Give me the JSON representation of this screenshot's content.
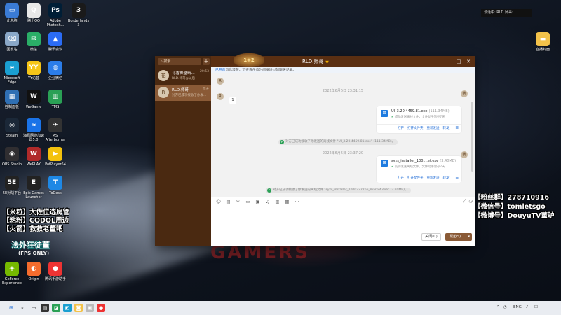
{
  "desktop_icons": [
    {
      "label": "此电脑",
      "color": "#3a7bd5",
      "glyph": "▭",
      "col": 0,
      "row": 0
    },
    {
      "label": "回收站",
      "color": "#8aa8c8",
      "glyph": "⌫",
      "col": 0,
      "row": 1
    },
    {
      "label": "Microsoft Edge",
      "color": "#1a9fd1",
      "glyph": "e",
      "col": 0,
      "row": 2
    },
    {
      "label": "控制面板",
      "color": "#2f6fb3",
      "glyph": "▦",
      "col": 0,
      "row": 3
    },
    {
      "label": "Steam",
      "color": "#1b2838",
      "glyph": "◎",
      "col": 0,
      "row": 4
    },
    {
      "label": "OBS Studio",
      "color": "#302e31",
      "glyph": "◉",
      "col": 0,
      "row": 5
    },
    {
      "label": "5E对战平台",
      "color": "#222",
      "glyph": "5E",
      "col": 0,
      "row": 6
    },
    {
      "label": "GeForce Experience",
      "color": "#76b900",
      "glyph": "◈",
      "col": 0,
      "row": 9
    },
    {
      "label": "腾讯QQ",
      "color": "#e8e8e8",
      "glyph": "Q",
      "col": 1,
      "row": 0
    },
    {
      "label": "微信",
      "color": "#2aae67",
      "glyph": "✉",
      "col": 1,
      "row": 1
    },
    {
      "label": "YY语音",
      "color": "#f5c518",
      "glyph": "YY",
      "col": 1,
      "row": 2
    },
    {
      "label": "WeGame",
      "color": "#111",
      "glyph": "W",
      "col": 1,
      "row": 3
    },
    {
      "label": "海豚网游加速器5.0",
      "color": "#1a73e8",
      "glyph": "≈",
      "col": 1,
      "row": 4
    },
    {
      "label": "WePLAY",
      "color": "#b02a2a",
      "glyph": "W",
      "col": 1,
      "row": 5
    },
    {
      "label": "Epic Games Launcher",
      "color": "#222",
      "glyph": "E",
      "col": 1,
      "row": 6
    },
    {
      "label": "Origin",
      "color": "#f56c2d",
      "glyph": "◐",
      "col": 1,
      "row": 9
    },
    {
      "label": "Adobe Photosh...",
      "color": "#001e36",
      "glyph": "Ps",
      "col": 2,
      "row": 0
    },
    {
      "label": "腾讯会议",
      "color": "#2b6cf6",
      "glyph": "▲",
      "col": 2,
      "row": 1
    },
    {
      "label": "企业微信",
      "color": "#2b7de9",
      "glyph": "◍",
      "col": 2,
      "row": 2
    },
    {
      "label": "TMS",
      "color": "#2aa055",
      "glyph": "▥",
      "col": 2,
      "row": 3
    },
    {
      "label": "MSI Afterburner",
      "color": "#333",
      "glyph": "✈",
      "col": 2,
      "row": 4
    },
    {
      "label": "PotPlayer64",
      "color": "#f4c20d",
      "glyph": "▶",
      "col": 2,
      "row": 5
    },
    {
      "label": "ToDesk",
      "color": "#1e88e5",
      "glyph": "T",
      "col": 2,
      "row": 6
    },
    {
      "label": "腾讯手游助手",
      "color": "#e33",
      "glyph": "●",
      "col": 2,
      "row": 9
    },
    {
      "label": "Borderlands 3",
      "color": "#1a1a1a",
      "glyph": "3",
      "col": 3,
      "row": 0
    },
    {
      "label": "直播封面",
      "color": "#f3c24a",
      "glyph": "▬",
      "col": 4,
      "row": 1
    }
  ],
  "notice": "谈话中: RLD.师哥:",
  "overlay_left": [
    "【米粒】大佐位选房管",
    "【粘粉】CODOL周边",
    "【火箭】救救老董吧"
  ],
  "overlay_right": [
    "【粉丝群】278710916",
    "【微信号】tomletsgo",
    "【微博号】DouyuTV董驴"
  ],
  "cam_badge": "法外狂徒董",
  "fps_badge": "(FPS ONLY)",
  "wallpaper_text": "GAMERS",
  "qq": {
    "title": "RLD.师哥",
    "dragon_text": "1+2",
    "search_placeholder": "搜索",
    "win_min": "–",
    "win_max": "□",
    "win_close": "✕",
    "conversations": [
      {
        "name": "花香椰壁纸...",
        "time": "20:53",
        "preview": "RLD.师哥@以后",
        "avatar": "花",
        "active": false
      },
      {
        "name": "RLD.师哥",
        "time": "昨天",
        "preview": "对方已成功接收了你发...",
        "avatar": "R",
        "active": true
      }
    ],
    "notice_prefix": "已开启",
    "notice_text": "消息漫游，可查看任意时间发送过的聊天记录。",
    "timestamps": [
      "2022年6月5日 23:31:15",
      "2022年6月5日 23:37:20"
    ],
    "msg_in": "1",
    "files": [
      {
        "name": "UI_3.20.4459.81.exe",
        "size": "(111.34MB)",
        "status": "成功发送离线文件，文件助手暂存7天",
        "actions": [
          "打开",
          "打开文件夹",
          "重新发送",
          "转发"
        ]
      },
      {
        "name": "syzs_installer_100....et.exe",
        "size": "(3.40MB)",
        "status": "成功发送离线文件，文件助手暂存7天",
        "actions": [
          "打开",
          "打开文件夹",
          "重新发送",
          "转发"
        ]
      }
    ],
    "sys_msgs": [
      "对方已成功接收了你发送的离线文件 \"UI_3.20.4459.81.exe\" (111.34MB)。",
      "对方已成功接收了你发送的离线文件 \"syzs_installer_1000227765_market.exe\" (3.40MB)。"
    ],
    "toolbar_icons": [
      "☺",
      "▤",
      "✂",
      "▭",
      "▣",
      "♫",
      "▥",
      "▦",
      "···"
    ],
    "btn_close": "关闭(C)",
    "btn_send": "发送(S)",
    "btn_send_dd": "▾"
  },
  "taskbar": {
    "icons": [
      "⊞",
      "⌕",
      "▭",
      "▤",
      "◪",
      "◩",
      "◙",
      "▣",
      "●"
    ],
    "sys_lang": "ENG",
    "sys_icons": [
      "⌃",
      "◔",
      "♪",
      "☐"
    ]
  }
}
